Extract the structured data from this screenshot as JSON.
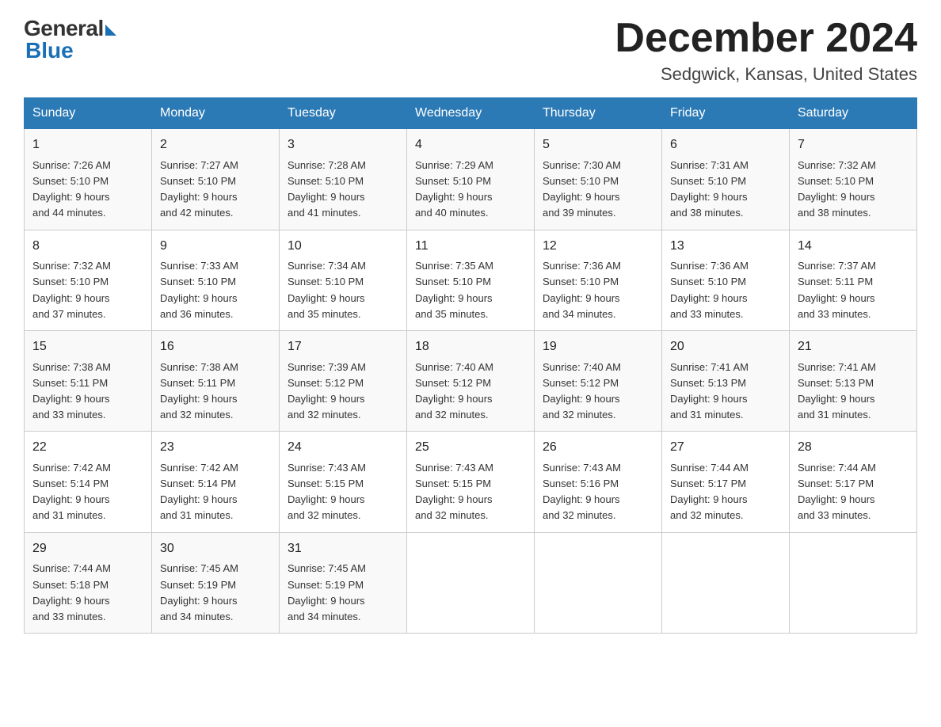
{
  "header": {
    "logo_general": "General",
    "logo_blue": "Blue",
    "month_title": "December 2024",
    "location": "Sedgwick, Kansas, United States"
  },
  "days_of_week": [
    "Sunday",
    "Monday",
    "Tuesday",
    "Wednesday",
    "Thursday",
    "Friday",
    "Saturday"
  ],
  "weeks": [
    [
      {
        "day": "1",
        "sunrise": "7:26 AM",
        "sunset": "5:10 PM",
        "daylight": "9 hours and 44 minutes."
      },
      {
        "day": "2",
        "sunrise": "7:27 AM",
        "sunset": "5:10 PM",
        "daylight": "9 hours and 42 minutes."
      },
      {
        "day": "3",
        "sunrise": "7:28 AM",
        "sunset": "5:10 PM",
        "daylight": "9 hours and 41 minutes."
      },
      {
        "day": "4",
        "sunrise": "7:29 AM",
        "sunset": "5:10 PM",
        "daylight": "9 hours and 40 minutes."
      },
      {
        "day": "5",
        "sunrise": "7:30 AM",
        "sunset": "5:10 PM",
        "daylight": "9 hours and 39 minutes."
      },
      {
        "day": "6",
        "sunrise": "7:31 AM",
        "sunset": "5:10 PM",
        "daylight": "9 hours and 38 minutes."
      },
      {
        "day": "7",
        "sunrise": "7:32 AM",
        "sunset": "5:10 PM",
        "daylight": "9 hours and 38 minutes."
      }
    ],
    [
      {
        "day": "8",
        "sunrise": "7:32 AM",
        "sunset": "5:10 PM",
        "daylight": "9 hours and 37 minutes."
      },
      {
        "day": "9",
        "sunrise": "7:33 AM",
        "sunset": "5:10 PM",
        "daylight": "9 hours and 36 minutes."
      },
      {
        "day": "10",
        "sunrise": "7:34 AM",
        "sunset": "5:10 PM",
        "daylight": "9 hours and 35 minutes."
      },
      {
        "day": "11",
        "sunrise": "7:35 AM",
        "sunset": "5:10 PM",
        "daylight": "9 hours and 35 minutes."
      },
      {
        "day": "12",
        "sunrise": "7:36 AM",
        "sunset": "5:10 PM",
        "daylight": "9 hours and 34 minutes."
      },
      {
        "day": "13",
        "sunrise": "7:36 AM",
        "sunset": "5:10 PM",
        "daylight": "9 hours and 33 minutes."
      },
      {
        "day": "14",
        "sunrise": "7:37 AM",
        "sunset": "5:11 PM",
        "daylight": "9 hours and 33 minutes."
      }
    ],
    [
      {
        "day": "15",
        "sunrise": "7:38 AM",
        "sunset": "5:11 PM",
        "daylight": "9 hours and 33 minutes."
      },
      {
        "day": "16",
        "sunrise": "7:38 AM",
        "sunset": "5:11 PM",
        "daylight": "9 hours and 32 minutes."
      },
      {
        "day": "17",
        "sunrise": "7:39 AM",
        "sunset": "5:12 PM",
        "daylight": "9 hours and 32 minutes."
      },
      {
        "day": "18",
        "sunrise": "7:40 AM",
        "sunset": "5:12 PM",
        "daylight": "9 hours and 32 minutes."
      },
      {
        "day": "19",
        "sunrise": "7:40 AM",
        "sunset": "5:12 PM",
        "daylight": "9 hours and 32 minutes."
      },
      {
        "day": "20",
        "sunrise": "7:41 AM",
        "sunset": "5:13 PM",
        "daylight": "9 hours and 31 minutes."
      },
      {
        "day": "21",
        "sunrise": "7:41 AM",
        "sunset": "5:13 PM",
        "daylight": "9 hours and 31 minutes."
      }
    ],
    [
      {
        "day": "22",
        "sunrise": "7:42 AM",
        "sunset": "5:14 PM",
        "daylight": "9 hours and 31 minutes."
      },
      {
        "day": "23",
        "sunrise": "7:42 AM",
        "sunset": "5:14 PM",
        "daylight": "9 hours and 31 minutes."
      },
      {
        "day": "24",
        "sunrise": "7:43 AM",
        "sunset": "5:15 PM",
        "daylight": "9 hours and 32 minutes."
      },
      {
        "day": "25",
        "sunrise": "7:43 AM",
        "sunset": "5:15 PM",
        "daylight": "9 hours and 32 minutes."
      },
      {
        "day": "26",
        "sunrise": "7:43 AM",
        "sunset": "5:16 PM",
        "daylight": "9 hours and 32 minutes."
      },
      {
        "day": "27",
        "sunrise": "7:44 AM",
        "sunset": "5:17 PM",
        "daylight": "9 hours and 32 minutes."
      },
      {
        "day": "28",
        "sunrise": "7:44 AM",
        "sunset": "5:17 PM",
        "daylight": "9 hours and 33 minutes."
      }
    ],
    [
      {
        "day": "29",
        "sunrise": "7:44 AM",
        "sunset": "5:18 PM",
        "daylight": "9 hours and 33 minutes."
      },
      {
        "day": "30",
        "sunrise": "7:45 AM",
        "sunset": "5:19 PM",
        "daylight": "9 hours and 34 minutes."
      },
      {
        "day": "31",
        "sunrise": "7:45 AM",
        "sunset": "5:19 PM",
        "daylight": "9 hours and 34 minutes."
      },
      null,
      null,
      null,
      null
    ]
  ],
  "labels": {
    "sunrise": "Sunrise:",
    "sunset": "Sunset:",
    "daylight": "Daylight:"
  }
}
